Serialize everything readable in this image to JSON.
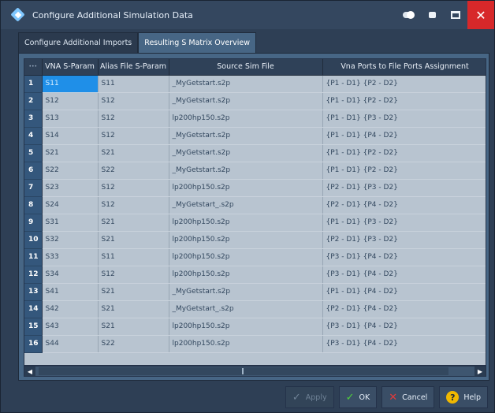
{
  "window": {
    "title": "Configure Additional Simulation Data"
  },
  "tabs": [
    {
      "label": "Configure Additional Imports"
    },
    {
      "label": "Resulting S Matrix Overview"
    }
  ],
  "table": {
    "corner_label": "•••",
    "headers": [
      "VNA S-Param",
      "Alias File S-Param",
      "Source Sim File",
      "Vna Ports to File Ports Assignment"
    ],
    "rows": [
      {
        "n": "1",
        "vna": "S11",
        "alias": "S11",
        "file": "_MyGetstart.s2p",
        "ports": "{P1 - D1} {P2 - D2}"
      },
      {
        "n": "2",
        "vna": "S12",
        "alias": "S12",
        "file": "_MyGetstart.s2p",
        "ports": "{P1 - D1} {P2 - D2}"
      },
      {
        "n": "3",
        "vna": "S13",
        "alias": "S12",
        "file": "lp200hp150.s2p",
        "ports": "{P1 - D1} {P3 - D2}"
      },
      {
        "n": "4",
        "vna": "S14",
        "alias": "S12",
        "file": "_MyGetstart.s2p",
        "ports": "{P1 - D1} {P4 - D2}"
      },
      {
        "n": "5",
        "vna": "S21",
        "alias": "S21",
        "file": "_MyGetstart.s2p",
        "ports": "{P1 - D1} {P2 - D2}"
      },
      {
        "n": "6",
        "vna": "S22",
        "alias": "S22",
        "file": "_MyGetstart.s2p",
        "ports": "{P1 - D1} {P2 - D2}"
      },
      {
        "n": "7",
        "vna": "S23",
        "alias": "S12",
        "file": "lp200hp150.s2p",
        "ports": "{P2 - D1} {P3 - D2}"
      },
      {
        "n": "8",
        "vna": "S24",
        "alias": "S12",
        "file": "_MyGetstart_.s2p",
        "ports": "{P2 - D1} {P4 - D2}"
      },
      {
        "n": "9",
        "vna": "S31",
        "alias": "S21",
        "file": "lp200hp150.s2p",
        "ports": "{P1 - D1} {P3 - D2}"
      },
      {
        "n": "10",
        "vna": "S32",
        "alias": "S21",
        "file": "lp200hp150.s2p",
        "ports": "{P2 - D1} {P3 - D2}"
      },
      {
        "n": "11",
        "vna": "S33",
        "alias": "S11",
        "file": "lp200hp150.s2p",
        "ports": "{P3 - D1} {P4 - D2}"
      },
      {
        "n": "12",
        "vna": "S34",
        "alias": "S12",
        "file": "lp200hp150.s2p",
        "ports": "{P3 - D1} {P4 - D2}"
      },
      {
        "n": "13",
        "vna": "S41",
        "alias": "S21",
        "file": "_MyGetstart.s2p",
        "ports": "{P1 - D1} {P4 - D2}"
      },
      {
        "n": "14",
        "vna": "S42",
        "alias": "S21",
        "file": "_MyGetstart_.s2p",
        "ports": "{P2 - D1} {P4 - D2}"
      },
      {
        "n": "15",
        "vna": "S43",
        "alias": "S21",
        "file": "lp200hp150.s2p",
        "ports": "{P3 - D1} {P4 - D2}"
      },
      {
        "n": "16",
        "vna": "S44",
        "alias": "S22",
        "file": "lp200hp150.s2p",
        "ports": "{P3 - D1} {P4 - D2}"
      }
    ]
  },
  "footer": {
    "apply_label": "Apply",
    "ok_label": "OK",
    "cancel_label": "Cancel",
    "help_label": "Help"
  },
  "colors": {
    "selected_cell": "#1f8fe8",
    "close_button": "#d7282a",
    "ok_check": "#4fd13a",
    "cancel_x": "#e23a3a",
    "help_badge": "#f0b800"
  },
  "icons": {
    "app": "rs-diamond-icon",
    "titlebar": [
      "toggle-icon",
      "minimize-icon",
      "maximize-icon",
      "close-icon"
    ],
    "apply": "check-icon",
    "ok": "check-icon",
    "cancel": "x-icon",
    "help": "question-icon"
  }
}
